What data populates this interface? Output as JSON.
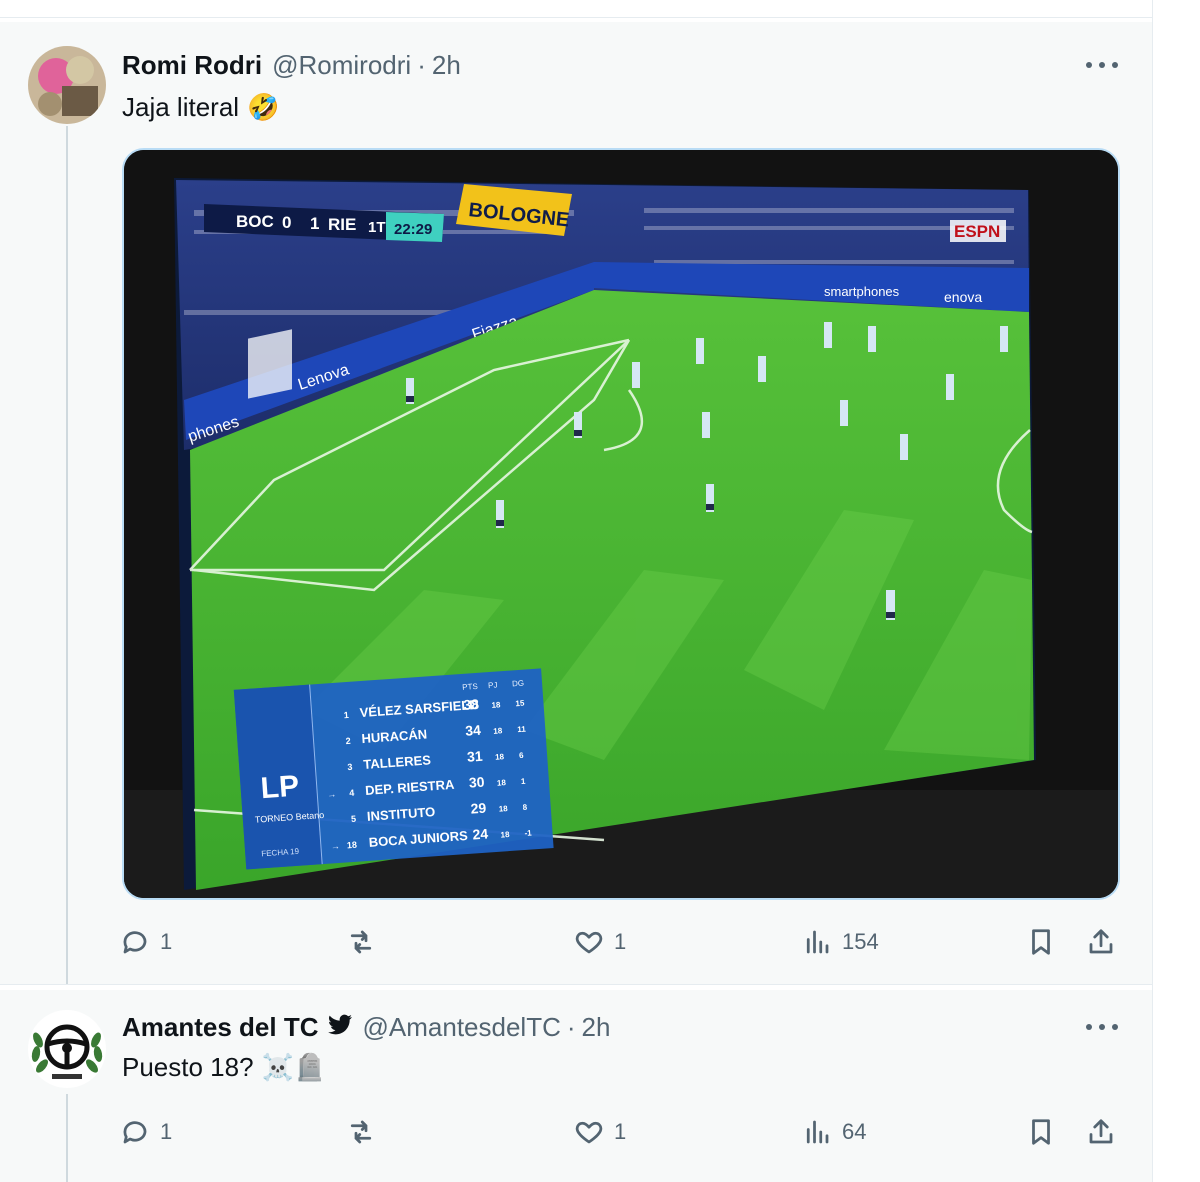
{
  "tweets": [
    {
      "author_name": "Romi Rodri",
      "handle": "@Romirodri",
      "separator": "·",
      "time": "2h",
      "text": "Jaja literal",
      "emoji": "🤣",
      "media": {
        "scorebug": {
          "home": "BOC",
          "home_score": "0",
          "away_score": "1",
          "away": "RIE",
          "period": "1T",
          "clock": "22:29"
        },
        "banner_text": "BOLOGNE",
        "broadcaster": "ESPN",
        "ad_texts": [
          "enova",
          "smartphones",
          "Fiazza",
          "phones",
          "Lenova"
        ],
        "standings": {
          "column_headers": [
            "PTS",
            "PJ",
            "DG"
          ],
          "rows": [
            {
              "pos": "1",
              "team": "VÉLEZ SARSFIELD",
              "pts": "38",
              "pj": "18",
              "dg": "15"
            },
            {
              "pos": "2",
              "team": "HURACÁN",
              "pts": "34",
              "pj": "18",
              "dg": "11"
            },
            {
              "pos": "3",
              "team": "TALLERES",
              "pts": "31",
              "pj": "18",
              "dg": "6"
            },
            {
              "pos": "4",
              "team": "DEP. RIESTRA",
              "pts": "30",
              "pj": "18",
              "dg": "1"
            },
            {
              "pos": "5",
              "team": "INSTITUTO",
              "pts": "29",
              "pj": "18",
              "dg": "8"
            },
            {
              "pos": "18",
              "team": "BOCA JUNIORS",
              "pts": "24",
              "pj": "18",
              "dg": "-1"
            }
          ],
          "logo_text": "TORNEO Betano",
          "footer": "FECHA 19"
        }
      },
      "actions": {
        "reply_count": "1",
        "repost_count": "",
        "like_count": "1",
        "views_count": "154"
      }
    },
    {
      "author_name": "Amantes del TC",
      "verified": true,
      "handle": "@AmantesdelTC",
      "separator": "·",
      "time": "2h",
      "text": "Puesto 18?",
      "emoji": "☠️🪦",
      "actions": {
        "reply_count": "1",
        "repost_count": "",
        "like_count": "1",
        "views_count": "64"
      }
    }
  ],
  "colors": {
    "text_primary": "#0f1419",
    "text_secondary": "#536471",
    "verified_blue": "#1d9bf0",
    "pitch_green": "#3fae2a",
    "standings_blue": "#1f62c4"
  }
}
